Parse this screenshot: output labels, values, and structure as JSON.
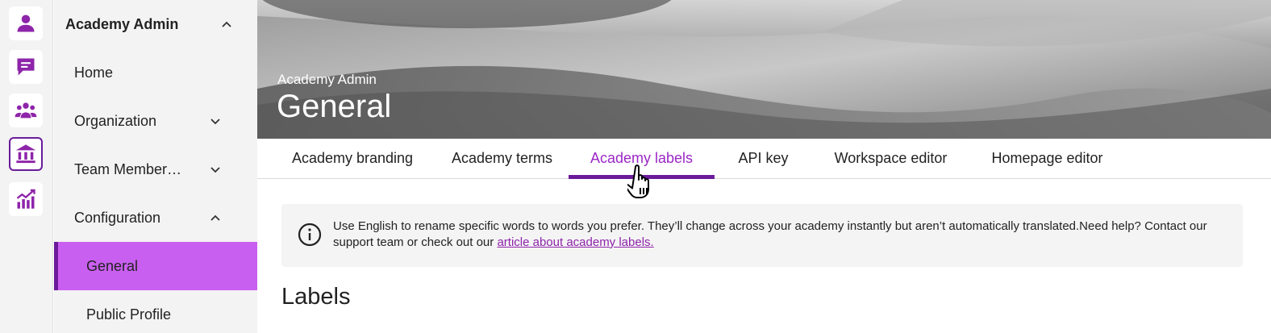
{
  "rail": {
    "items": [
      {
        "name": "profile"
      },
      {
        "name": "messages"
      },
      {
        "name": "teams"
      },
      {
        "name": "academy-admin",
        "active": true
      },
      {
        "name": "analytics"
      }
    ]
  },
  "nav": {
    "header": "Academy Admin",
    "items": [
      {
        "label": "Home"
      },
      {
        "label": "Organization"
      },
      {
        "label": "Team Member…"
      },
      {
        "label": "Configuration"
      },
      {
        "label": "General"
      },
      {
        "label": "Public Profile"
      }
    ]
  },
  "hero": {
    "subtitle": "Academy Admin",
    "title": "General"
  },
  "tabs": [
    {
      "label": "Academy branding"
    },
    {
      "label": "Academy terms"
    },
    {
      "label": "Academy labels",
      "active": true
    },
    {
      "label": "API key"
    },
    {
      "label": "Workspace editor"
    },
    {
      "label": "Homepage editor"
    }
  ],
  "info": {
    "text": "Use English to rename specific words to words you prefer. They’ll change across your academy instantly but aren’t automatically translated.Need help? Contact our support team or check out our ",
    "link": "article about academy labels."
  },
  "section": {
    "title": "Labels"
  },
  "colors": {
    "accent": "#6a1b9a",
    "accent_light": "#c95ff0",
    "active_tab_text": "#9b27c5",
    "icon": "#8e24aa"
  }
}
